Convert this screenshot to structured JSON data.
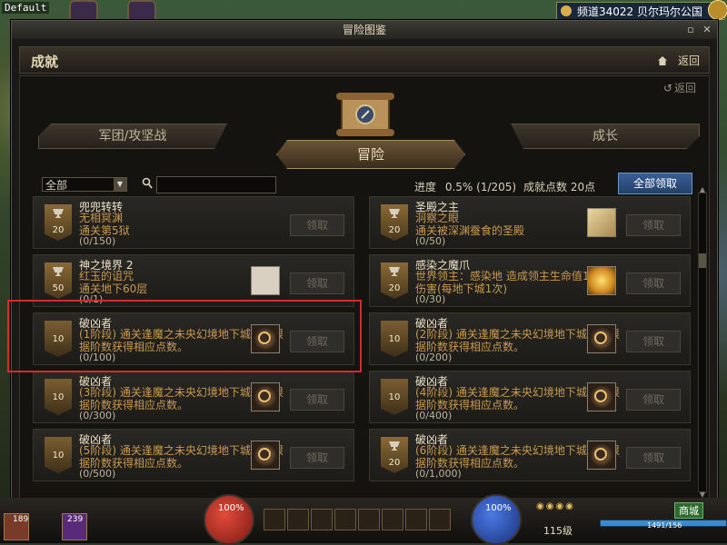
{
  "game": {
    "tag": "Default",
    "channel": "频道34022 贝尔玛尔公国"
  },
  "window": {
    "title": "冒险图鉴",
    "section": "成就",
    "back_label": "返回",
    "inner_back_label": "返回"
  },
  "tabs": {
    "left": "军团/攻坚战",
    "middle": "冒险",
    "right": "成长"
  },
  "filter": {
    "selected": "全部",
    "search_value": ""
  },
  "progress_label": "进度",
  "progress_value": "0.5% (1/205)",
  "points_label": "成就点数 20点",
  "claim_all_label": "全部领取",
  "claim_label": "领取",
  "achievements": [
    {
      "points": "20",
      "trophy": true,
      "title": "兜兜转转",
      "desc": "无相冥渊\n通关第5狱",
      "count": "(0/150)",
      "icon": ""
    },
    {
      "points": "20",
      "trophy": true,
      "title": "圣殿之主",
      "desc": "洞察之眼\n通关被深渊蚕食的圣殿",
      "count": "(0/50)",
      "icon": "map"
    },
    {
      "points": "50",
      "trophy": true,
      "title": "神之境界 2",
      "desc": "红玉的诅咒\n通关地下60层",
      "count": "(0/1)",
      "icon": "letter"
    },
    {
      "points": "20",
      "trophy": true,
      "title": "感染之魔爪",
      "desc": "世界领主：感染地      造成领主生命值100%伤害(每地下城1次)",
      "count": "(0/30)",
      "icon": "gold"
    },
    {
      "points": "10",
      "trophy": false,
      "title": "破凶者",
      "desc": "(1阶段) 通关逢魔之未央幻境地下城时，根据阶数获得相应点数。",
      "count": "(0/100)",
      "icon": "emblem"
    },
    {
      "points": "10",
      "trophy": false,
      "title": "破凶者",
      "desc": "(2阶段) 通关逢魔之未央幻境地下城时，根据阶数获得相应点数。",
      "count": "(0/200)",
      "icon": "emblem"
    },
    {
      "points": "10",
      "trophy": false,
      "title": "破凶者",
      "desc": "(3阶段) 通关逢魔之未央幻境地下城时，根据阶数获得相应点数。",
      "count": "(0/300)",
      "icon": "emblem"
    },
    {
      "points": "10",
      "trophy": false,
      "title": "破凶者",
      "desc": "(4阶段) 通关逢魔之未央幻境地下城时，根据阶数获得相应点数。",
      "count": "(0/400)",
      "icon": "emblem"
    },
    {
      "points": "10",
      "trophy": false,
      "title": "破凶者",
      "desc": "(5阶段) 通关逢魔之未央幻境地下城时，根据阶数获得相应点数。",
      "count": "(0/500)",
      "icon": "emblem"
    },
    {
      "points": "20",
      "trophy": true,
      "title": "破凶者",
      "desc": "(6阶段) 通关逢魔之未央幻境地下城时，根据阶数获得相应点数。",
      "count": "(0/1,000)",
      "icon": "emblem"
    }
  ],
  "hud": {
    "hp": "100%",
    "mp": "100%",
    "item1_count": "189",
    "item2_count": "239",
    "level": "115级",
    "exp": "1491/156",
    "shop_label": "商城"
  }
}
